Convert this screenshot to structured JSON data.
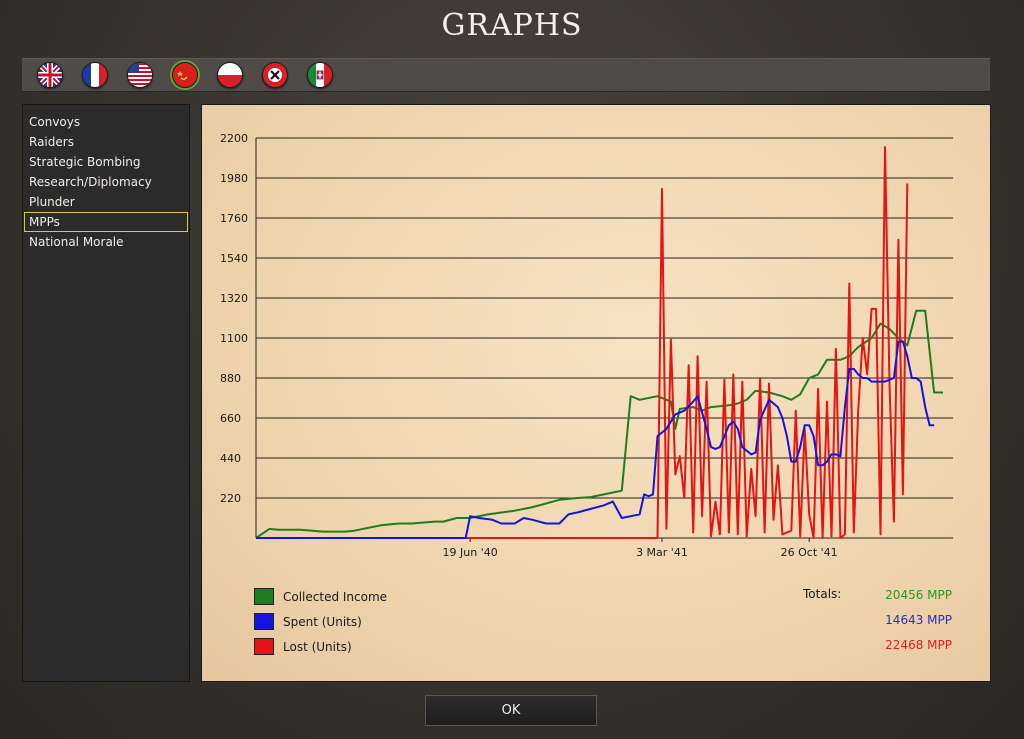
{
  "window": {
    "title": "GRAPHS"
  },
  "flags": [
    {
      "name": "uk-flag-icon",
      "selected": false
    },
    {
      "name": "france-flag-icon",
      "selected": false
    },
    {
      "name": "usa-flag-icon",
      "selected": false
    },
    {
      "name": "ussr-flag-icon",
      "selected": true
    },
    {
      "name": "poland-flag-icon",
      "selected": false
    },
    {
      "name": "germany-flag-icon",
      "selected": false
    },
    {
      "name": "italy-flag-icon",
      "selected": false
    }
  ],
  "sidebar": {
    "items": [
      {
        "label": "Convoys"
      },
      {
        "label": "Raiders"
      },
      {
        "label": "Strategic Bombing"
      },
      {
        "label": "Research/Diplomacy"
      },
      {
        "label": "Plunder"
      },
      {
        "label": "MPPs"
      },
      {
        "label": "National Morale"
      }
    ],
    "active": "MPPs"
  },
  "chart_data": {
    "type": "line",
    "y_ticks": [
      "2200",
      "1980",
      "1760",
      "1540",
      "1320",
      "1100",
      "880",
      "660",
      "440",
      "220"
    ],
    "x_ticks": [
      "19 Jun '40",
      "3 Mar '41",
      "26 Oct '41"
    ],
    "ylim": [
      0,
      2200
    ],
    "grid": true,
    "series": [
      {
        "name": "Collected Income",
        "color": "#1e7d1e",
        "points": [
          [
            0,
            0
          ],
          [
            3,
            50
          ],
          [
            5,
            45
          ],
          [
            10,
            45
          ],
          [
            15,
            35
          ],
          [
            20,
            35
          ],
          [
            22,
            40
          ],
          [
            25,
            55
          ],
          [
            28,
            70
          ],
          [
            32,
            80
          ],
          [
            35,
            80
          ],
          [
            40,
            90
          ],
          [
            42,
            90
          ],
          [
            45,
            110
          ],
          [
            48,
            110
          ],
          [
            52,
            130
          ],
          [
            55,
            140
          ],
          [
            58,
            150
          ],
          [
            62,
            170
          ],
          [
            65,
            190
          ],
          [
            68,
            210
          ],
          [
            72,
            220
          ],
          [
            75,
            225
          ],
          [
            78,
            240
          ],
          [
            80,
            250
          ],
          [
            82,
            260
          ],
          [
            84,
            780
          ],
          [
            86,
            760
          ],
          [
            90,
            780
          ],
          [
            93,
            750
          ],
          [
            94,
            600
          ],
          [
            95,
            710
          ],
          [
            98,
            720
          ],
          [
            100,
            700
          ],
          [
            102,
            720
          ],
          [
            106,
            730
          ],
          [
            108,
            740
          ],
          [
            110,
            760
          ],
          [
            112,
            810
          ],
          [
            115,
            800
          ],
          [
            118,
            780
          ],
          [
            120,
            760
          ],
          [
            122,
            790
          ],
          [
            124,
            880
          ],
          [
            126,
            900
          ],
          [
            128,
            980
          ],
          [
            131,
            980
          ],
          [
            133,
            1000
          ],
          [
            135,
            1050
          ],
          [
            138,
            1100
          ],
          [
            140,
            1180
          ],
          [
            142,
            1150
          ],
          [
            144,
            1100
          ],
          [
            146,
            1060
          ],
          [
            148,
            1250
          ],
          [
            150,
            1250
          ],
          [
            152,
            800
          ],
          [
            154,
            800
          ]
        ]
      },
      {
        "name": "Spent (Units)",
        "color": "#1414e0",
        "points": [
          [
            0,
            0
          ],
          [
            47,
            0
          ],
          [
            48,
            120
          ],
          [
            50,
            110
          ],
          [
            53,
            100
          ],
          [
            55,
            80
          ],
          [
            58,
            80
          ],
          [
            60,
            110
          ],
          [
            62,
            100
          ],
          [
            65,
            80
          ],
          [
            68,
            80
          ],
          [
            70,
            130
          ],
          [
            72,
            140
          ],
          [
            75,
            160
          ],
          [
            78,
            180
          ],
          [
            80,
            200
          ],
          [
            82,
            110
          ],
          [
            84,
            120
          ],
          [
            86,
            130
          ],
          [
            87,
            240
          ],
          [
            88,
            230
          ],
          [
            89,
            240
          ],
          [
            90,
            560
          ],
          [
            92,
            600
          ],
          [
            94,
            680
          ],
          [
            96,
            700
          ],
          [
            98,
            750
          ],
          [
            99,
            780
          ],
          [
            101,
            600
          ],
          [
            102,
            500
          ],
          [
            103,
            490
          ],
          [
            104,
            500
          ],
          [
            106,
            620
          ],
          [
            107,
            640
          ],
          [
            108,
            600
          ],
          [
            109,
            500
          ],
          [
            110,
            480
          ],
          [
            111,
            460
          ],
          [
            112,
            470
          ],
          [
            113,
            650
          ],
          [
            115,
            760
          ],
          [
            117,
            720
          ],
          [
            118,
            660
          ],
          [
            119,
            560
          ],
          [
            120,
            420
          ],
          [
            121,
            420
          ],
          [
            122,
            500
          ],
          [
            123,
            620
          ],
          [
            124,
            620
          ],
          [
            125,
            560
          ],
          [
            126,
            400
          ],
          [
            127,
            400
          ],
          [
            128,
            420
          ],
          [
            129,
            460
          ],
          [
            130,
            460
          ],
          [
            131,
            450
          ],
          [
            132,
            720
          ],
          [
            133,
            930
          ],
          [
            134,
            930
          ],
          [
            135,
            900
          ],
          [
            136,
            880
          ],
          [
            137,
            880
          ],
          [
            138,
            860
          ],
          [
            139,
            860
          ],
          [
            140,
            860
          ],
          [
            141,
            860
          ],
          [
            142,
            870
          ],
          [
            143,
            880
          ],
          [
            144,
            1080
          ],
          [
            145,
            1080
          ],
          [
            146,
            1000
          ],
          [
            147,
            880
          ],
          [
            148,
            880
          ],
          [
            149,
            860
          ],
          [
            150,
            720
          ],
          [
            151,
            620
          ],
          [
            152,
            620
          ]
        ]
      },
      {
        "name": "Lost (Units)",
        "color": "#e61414",
        "points": [
          [
            0,
            0
          ],
          [
            90,
            0
          ],
          [
            91,
            1920
          ],
          [
            92,
            50
          ],
          [
            93,
            1090
          ],
          [
            94,
            350
          ],
          [
            95,
            450
          ],
          [
            96,
            220
          ],
          [
            97,
            950
          ],
          [
            98,
            30
          ],
          [
            99,
            1000
          ],
          [
            100,
            120
          ],
          [
            101,
            860
          ],
          [
            102,
            10
          ],
          [
            103,
            200
          ],
          [
            104,
            20
          ],
          [
            105,
            870
          ],
          [
            106,
            30
          ],
          [
            107,
            900
          ],
          [
            108,
            20
          ],
          [
            109,
            860
          ],
          [
            110,
            10
          ],
          [
            111,
            380
          ],
          [
            112,
            120
          ],
          [
            113,
            880
          ],
          [
            114,
            30
          ],
          [
            115,
            850
          ],
          [
            116,
            100
          ],
          [
            117,
            400
          ],
          [
            118,
            20
          ],
          [
            119,
            30
          ],
          [
            120,
            40
          ],
          [
            121,
            700
          ],
          [
            122,
            10
          ],
          [
            123,
            600
          ],
          [
            124,
            130
          ],
          [
            125,
            0
          ],
          [
            126,
            820
          ],
          [
            127,
            0
          ],
          [
            128,
            750
          ],
          [
            129,
            10
          ],
          [
            130,
            1040
          ],
          [
            131,
            0
          ],
          [
            132,
            20
          ],
          [
            133,
            1400
          ],
          [
            134,
            30
          ],
          [
            135,
            700
          ],
          [
            136,
            1100
          ],
          [
            137,
            900
          ],
          [
            138,
            1260
          ],
          [
            139,
            1260
          ],
          [
            140,
            20
          ],
          [
            141,
            2150
          ],
          [
            142,
            850
          ],
          [
            143,
            90
          ],
          [
            144,
            1640
          ],
          [
            145,
            240
          ],
          [
            146,
            1950
          ]
        ]
      }
    ]
  },
  "legend": [
    {
      "label": "Collected Income",
      "color": "#1e7d1e"
    },
    {
      "label": "Spent (Units)",
      "color": "#1414e0"
    },
    {
      "label": "Lost (Units)",
      "color": "#e61414"
    }
  ],
  "totals": {
    "label": "Totals:",
    "values": [
      {
        "text": "20456 MPP",
        "color": "#2a9a1e"
      },
      {
        "text": "14643 MPP",
        "color": "#2c2cc8"
      },
      {
        "text": "22468 MPP",
        "color": "#e02020"
      }
    ]
  },
  "buttons": {
    "ok": "OK"
  }
}
